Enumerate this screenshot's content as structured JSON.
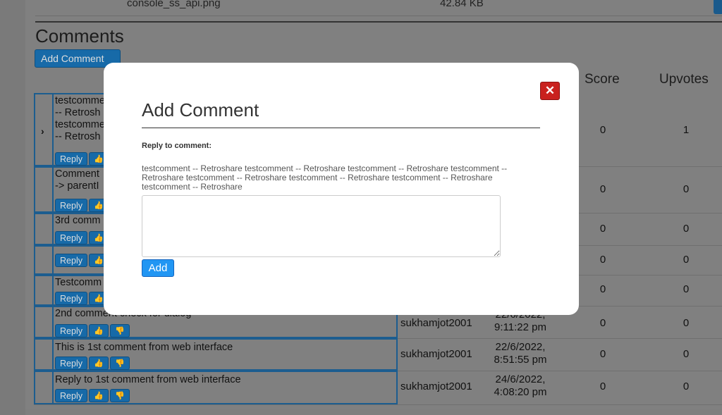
{
  "attachment": {
    "name": "console_ss_api.png",
    "size": "42.84 KB"
  },
  "comments_section": {
    "heading": "Comments",
    "add_comment_label": "Add Comment",
    "columns": {
      "score": "Score",
      "upvotes": "Upvotes"
    },
    "rows": [
      {
        "text": "testcomme\n-- Retrosh\ntestcomme\n-- Retrosh",
        "author": "",
        "date": "",
        "score": "0",
        "upvotes": "1",
        "expand": "›"
      },
      {
        "text": "Comment\n-> parentI",
        "author": "",
        "date": "",
        "score": "0",
        "upvotes": "0"
      },
      {
        "text": "3rd comm",
        "author": "",
        "date": "",
        "score": "0",
        "upvotes": "0"
      },
      {
        "text": "",
        "author": "",
        "date": "",
        "score": "0",
        "upvotes": "0"
      },
      {
        "text": "Testcomm",
        "author": "",
        "date": "",
        "score": "0",
        "upvotes": "0"
      },
      {
        "text": "2nd comment check for dialog",
        "author": "sukhamjot2001",
        "date": "22/6/2022,\n9:11:22 pm",
        "score": "0",
        "upvotes": "0"
      },
      {
        "text": "This is 1st comment from web interface",
        "author": "sukhamjot2001",
        "date": "22/6/2022,\n8:51:55 pm",
        "score": "0",
        "upvotes": "0"
      },
      {
        "text": "Reply to 1st comment from web interface",
        "author": "sukhamjot2001",
        "date": "24/6/2022,\n4:08:20 pm",
        "score": "0",
        "upvotes": "0"
      }
    ],
    "reply_label": "Reply",
    "upvote_icon": "thumbs-up-icon",
    "downvote_icon": "thumbs-down-icon"
  },
  "modal": {
    "title": "Add Comment",
    "close_icon": "close-icon",
    "reply_to_label": "Reply to comment:",
    "reply_to_text": " testcomment -- Retroshare  testcomment -- Retroshare  testcomment -- Retroshare  testcomment -- Retroshare  testcomment -- Retroshare  testcomment -- Retroshare  testcomment -- Retroshare testcomment -- Retroshare",
    "textarea_value": "",
    "add_label": "Add"
  }
}
